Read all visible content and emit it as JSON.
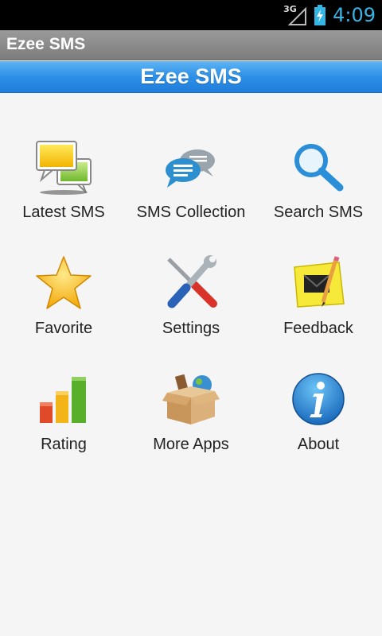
{
  "status": {
    "network": "3G",
    "time": "4:09"
  },
  "titlebar": {
    "title": "Ezee SMS"
  },
  "header": {
    "title": "Ezee SMS"
  },
  "menu": [
    {
      "label": "Latest SMS",
      "icon": "chat-bubbles-icon"
    },
    {
      "label": "SMS Collection",
      "icon": "message-bubbles-icon"
    },
    {
      "label": "Search SMS",
      "icon": "magnifier-icon"
    },
    {
      "label": "Favorite",
      "icon": "star-icon"
    },
    {
      "label": "Settings",
      "icon": "tools-icon"
    },
    {
      "label": "Feedback",
      "icon": "envelope-note-icon"
    },
    {
      "label": "Rating",
      "icon": "bar-chart-icon"
    },
    {
      "label": "More Apps",
      "icon": "box-icon"
    },
    {
      "label": "About",
      "icon": "info-icon"
    }
  ],
  "colors": {
    "accent": "#33b5e5",
    "header_blue": "#2d8fe6",
    "titlebar_gray": "#8a8a8a"
  }
}
